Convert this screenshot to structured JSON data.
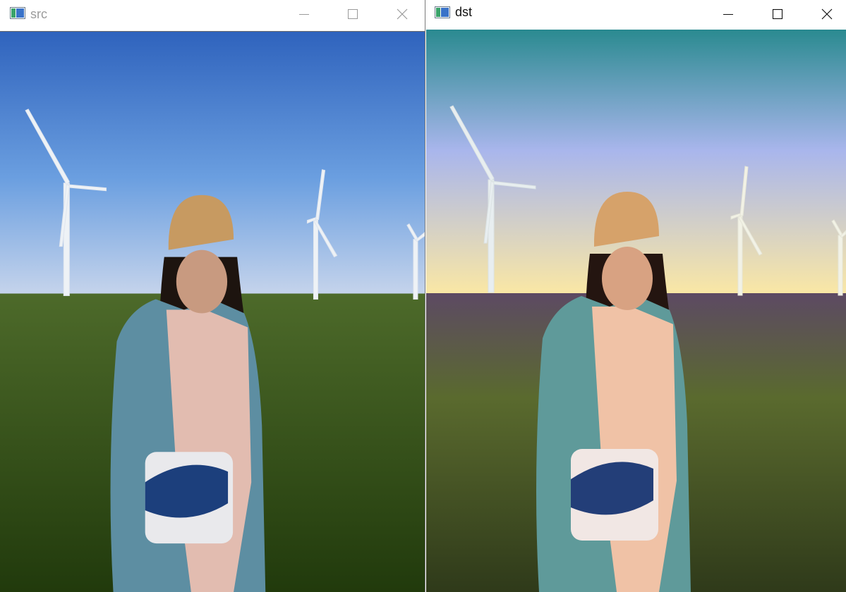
{
  "windows": [
    {
      "title": "src",
      "icon": "opencv-window-icon",
      "controls": [
        "minimize-icon",
        "maximize-icon",
        "close-icon"
      ],
      "image": {
        "description_type": "photo",
        "sky_top": "#2f63bd",
        "sky_mid": "#6b9fe0",
        "sky_horizon": "#c9d6ec",
        "grass_top": "#4d6a2a",
        "grass_bottom": "#213a0c",
        "cardigan": "#5d8ea2",
        "shirt": "#e2bcb0",
        "cap": "#c79a61",
        "bag": "#e9e9ec"
      }
    },
    {
      "title": "dst",
      "icon": "opencv-window-icon",
      "controls": [
        "minimize-icon",
        "maximize-icon",
        "close-icon"
      ],
      "image": {
        "description_type": "photo",
        "sky_top": "#2a8a90",
        "sky_mid": "#a9b6ec",
        "sky_horizon": "#fde9a2",
        "grass_top": "#5d4a63",
        "grass_bottom": "#2f3a1a",
        "cardigan": "#5f9a9a",
        "shirt": "#f0c2a6",
        "cap": "#d6a26a",
        "bag": "#f1e7e4"
      }
    }
  ]
}
